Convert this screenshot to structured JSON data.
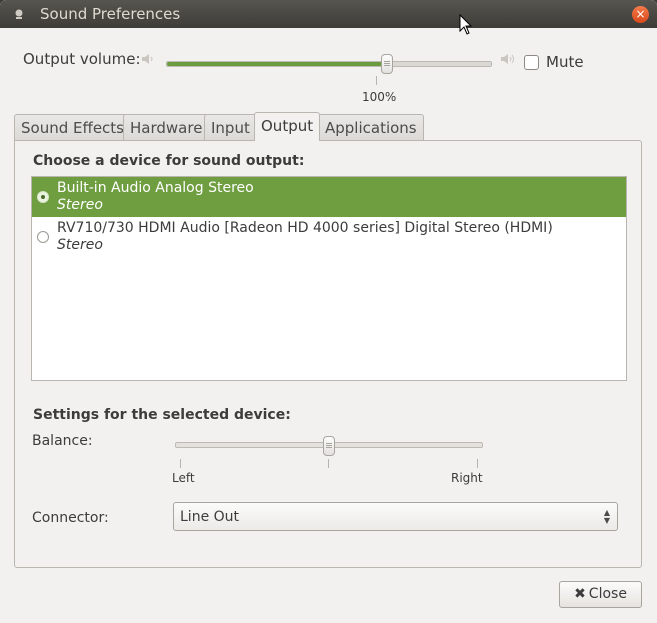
{
  "window": {
    "title": "Sound Preferences",
    "close_icon": "×"
  },
  "output_volume": {
    "label": "Output volume:",
    "value_text": "100%",
    "level": 0.68,
    "mute_label": "Mute",
    "mute_checked": false
  },
  "tabs": [
    {
      "label": "Sound Effects",
      "active": false
    },
    {
      "label": "Hardware",
      "active": false
    },
    {
      "label": "Input",
      "active": false
    },
    {
      "label": "Output",
      "active": true
    },
    {
      "label": "Applications",
      "active": false
    }
  ],
  "output": {
    "choose_heading": "Choose a device for sound output:",
    "devices": [
      {
        "name": "Built-in Audio Analog Stereo",
        "profile": "Stereo",
        "selected": true
      },
      {
        "name": "RV710/730 HDMI Audio [Radeon HD 4000 series] Digital Stereo (HDMI)",
        "profile": "Stereo",
        "selected": false
      }
    ],
    "settings_heading": "Settings for the selected device:",
    "balance": {
      "label": "Balance:",
      "left_label": "Left",
      "right_label": "Right",
      "value": 0.5
    },
    "connector": {
      "label": "Connector:",
      "value": "Line Out"
    }
  },
  "footer": {
    "close_label": "Close",
    "close_icon": "✖"
  },
  "colors": {
    "accent_green": "#6f9e41",
    "titlebar": "#3d3c38",
    "close_orange": "#e0582a"
  }
}
